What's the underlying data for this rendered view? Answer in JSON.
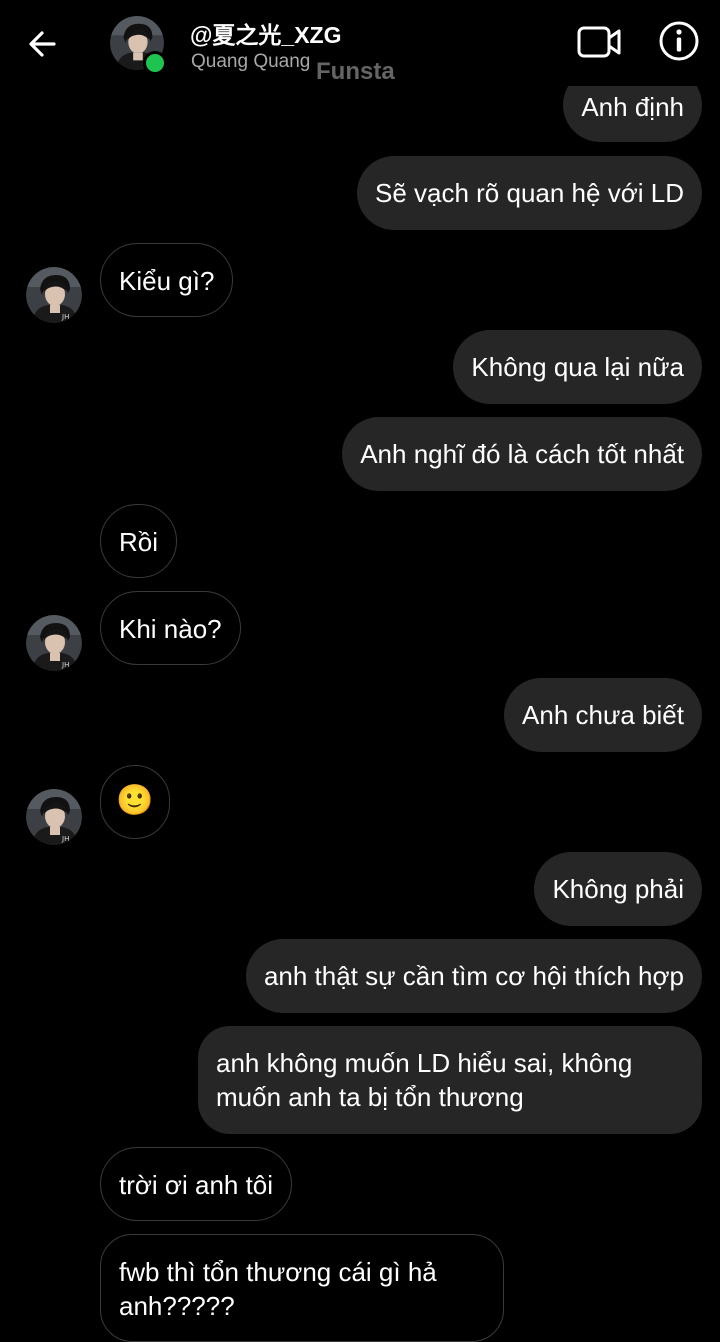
{
  "header": {
    "username": "@夏之光_XZG",
    "subtitle": "Quang Quang",
    "watermark": "Funsta"
  },
  "messages": [
    {
      "side": "sent",
      "text": "Anh định"
    },
    {
      "side": "sent",
      "text": "Sẽ vạch rõ quan hệ với LD"
    },
    {
      "side": "received",
      "text": "Kiểu gì?"
    },
    {
      "side": "sent",
      "text": "Không qua lại nữa"
    },
    {
      "side": "sent",
      "text": "Anh nghĩ đó là cách tốt nhất"
    },
    {
      "side": "received",
      "text": "Rồi"
    },
    {
      "side": "received",
      "text": "Khi nào?"
    },
    {
      "side": "sent",
      "text": "Anh chưa biết"
    },
    {
      "side": "received",
      "text": "🙂"
    },
    {
      "side": "sent",
      "text": "Không phải"
    },
    {
      "side": "sent",
      "text": "anh thật sự cần tìm cơ hội thích hợp"
    },
    {
      "side": "sent",
      "text": "anh không muốn LD hiểu sai, không muốn anh ta bị tổn thương"
    },
    {
      "side": "received",
      "text": "trời ơi anh tôi"
    },
    {
      "side": "received",
      "text": "fwb thì tổn thương cái gì hả anh?????"
    }
  ],
  "icons": {
    "back": "arrow-left-icon",
    "video": "video-camera-icon",
    "info": "info-icon"
  },
  "colors": {
    "background": "#000000",
    "sent_bubble": "#262626",
    "received_border": "#3a3a3a",
    "online_dot": "#1fc34f",
    "subtitle": "#a8a8a8"
  }
}
